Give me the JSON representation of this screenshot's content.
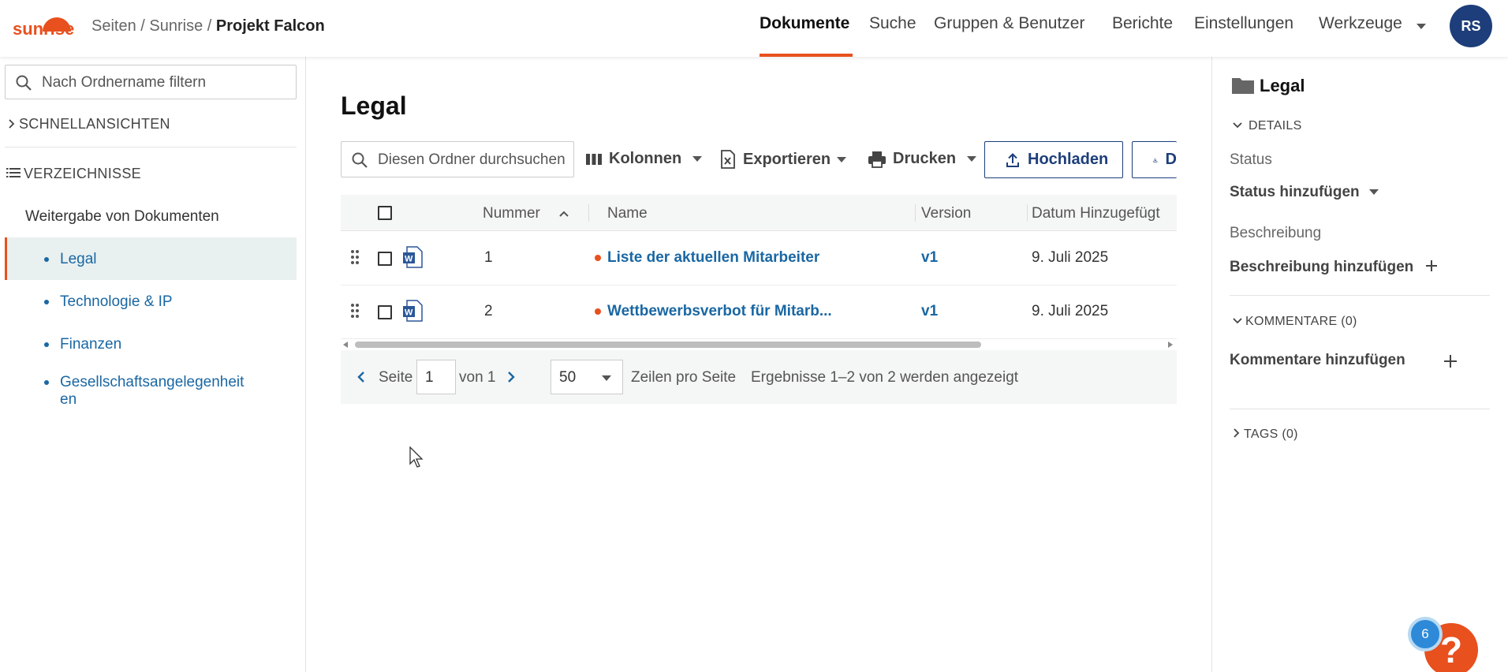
{
  "header": {
    "logo": "sunrise",
    "breadcrumb": {
      "part1": "Seiten",
      "sep": " / ",
      "part2": "Sunrise",
      "current": "Projekt Falcon"
    },
    "nav": [
      "Dokumente",
      "Suche",
      "Gruppen & Benutzer",
      "Berichte",
      "Einstellungen",
      "Werkzeuge"
    ],
    "active_nav": "Dokumente",
    "avatar": "RS",
    "colors": {
      "accent": "#e8501e",
      "navy": "#1d3e7a",
      "link": "#1a67a3"
    }
  },
  "sidebar": {
    "filter_placeholder": "Nach Ordnername filtern",
    "quick_views": "SCHNELLANSICHTEN",
    "directories": "VERZEICHNISSE",
    "group": "Weitergabe von Dokumenten",
    "items": [
      "Legal",
      "Technologie & IP",
      "Finanzen",
      "Gesellschaftsangelegenheit",
      "en"
    ]
  },
  "main": {
    "title": "Legal",
    "search_placeholder": "Diesen Ordner durchsuchen",
    "toolbar": {
      "columns": "Kolonnen",
      "export": "Exportieren",
      "print": "Drucken",
      "upload": "Hochladen",
      "download": "D"
    },
    "table": {
      "headers": [
        "Nummer",
        "Name",
        "Version",
        "Datum Hinzugefügt"
      ],
      "rows": [
        {
          "number": "1",
          "name": "Liste der aktuellen Mitarbeiter",
          "version": "v1",
          "date": "9. Juli 2025",
          "icon": "word-doc-icon"
        },
        {
          "number": "2",
          "name": "Wettbewerbsverbot für Mitarb...",
          "version": "v1",
          "date": "9. Juli 2025",
          "icon": "word-doc-icon"
        }
      ]
    },
    "pager": {
      "page_label": "Seite",
      "page": "1",
      "of_label": "von 1",
      "page_size": "50",
      "rows_label": "Zeilen pro Seite",
      "results": "Ergebnisse 1–2 von 2 werden angezeigt"
    }
  },
  "details": {
    "title": "Legal",
    "details_section": "DETAILS",
    "status_label": "Status",
    "status_action": "Status hinzufügen",
    "description_label": "Beschreibung",
    "description_action": "Beschreibung hinzufügen",
    "comments_section": "KOMMENTARE (0)",
    "comments_action": "Kommentare hinzufügen",
    "tags_section": "TAGS (0)"
  },
  "help": {
    "badge_count": "6",
    "icon": "?"
  }
}
